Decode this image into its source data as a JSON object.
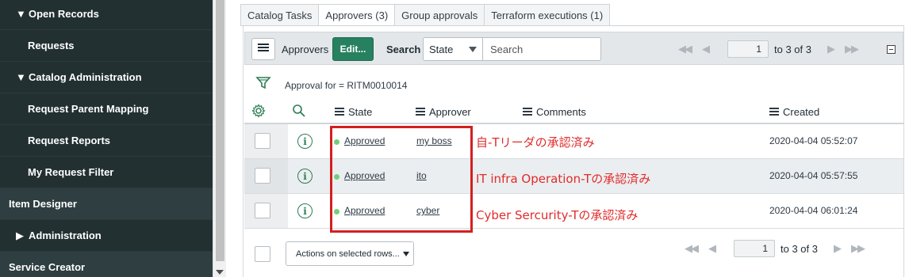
{
  "sidebar": {
    "items": [
      {
        "label": "Open Records",
        "prefix": "▼",
        "level": 1,
        "section": false
      },
      {
        "label": "Requests",
        "prefix": "",
        "level": 2,
        "section": false
      },
      {
        "label": "Catalog Administration",
        "prefix": "▼",
        "level": 1,
        "section": false
      },
      {
        "label": "Request Parent Mapping",
        "prefix": "",
        "level": 2,
        "section": false
      },
      {
        "label": "Request Reports",
        "prefix": "",
        "level": 2,
        "section": false
      },
      {
        "label": "My Request Filter",
        "prefix": "",
        "level": 2,
        "section": false
      },
      {
        "label": "Item Designer",
        "prefix": "",
        "level": 0,
        "section": true
      },
      {
        "label": "Administration",
        "prefix": "▶",
        "level": 1,
        "section": false
      },
      {
        "label": "Service Creator",
        "prefix": "",
        "level": 0,
        "section": true
      }
    ]
  },
  "tabs": [
    {
      "label": "Catalog Tasks",
      "active": false
    },
    {
      "label": "Approvers (3)",
      "active": true
    },
    {
      "label": "Group approvals",
      "active": false
    },
    {
      "label": "Terraform executions (1)",
      "active": false
    }
  ],
  "list_header": {
    "title": "Approvers",
    "edit_label": "Edit...",
    "search_label": "Search",
    "search_field": "State",
    "search_placeholder": "Search"
  },
  "pager_top": {
    "page": "1",
    "range_text": "to 3 of 3"
  },
  "filter": {
    "text": "Approval for = RITM0010014"
  },
  "columns": {
    "state": "State",
    "approver": "Approver",
    "comments": "Comments",
    "created": "Created"
  },
  "rows": [
    {
      "state": "Approved",
      "approver": "my boss",
      "created": "2020-04-04 05:52:07",
      "annotation": "自-Tリーダの承認済み"
    },
    {
      "state": "Approved",
      "approver": "ito",
      "created": "2020-04-04 05:57:55",
      "annotation": "IT infra Operation-Tの承認済み"
    },
    {
      "state": "Approved",
      "approver": "cyber",
      "created": "2020-04-04 06:01:24",
      "annotation": "Cyber Sercurity-Tの承認済み"
    }
  ],
  "footer": {
    "actions_label": "Actions on selected rows...",
    "page": "1",
    "range_text": "to 3 of 3"
  },
  "colors": {
    "sidebar_bg": "#233032",
    "edit_button": "#278160",
    "approved_dot": "#71cf7a",
    "annotation": "#e12b2b",
    "highlight_box": "#d41f1f"
  }
}
